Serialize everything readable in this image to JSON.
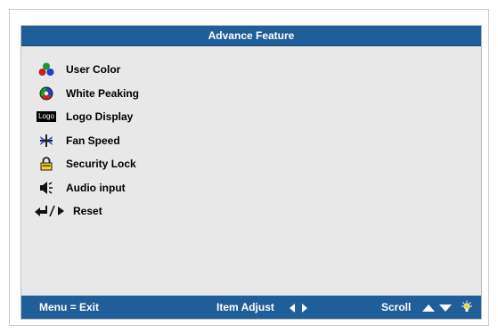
{
  "title": "Advance Feature",
  "menu": [
    {
      "label": "User Color",
      "icon": "user-color-icon"
    },
    {
      "label": "White Peaking",
      "icon": "white-peaking-icon"
    },
    {
      "label": "Logo Display",
      "icon": "logo-display-icon",
      "icon_text": "Logo"
    },
    {
      "label": "Fan Speed",
      "icon": "fan-icon"
    },
    {
      "label": "Security Lock",
      "icon": "lock-icon"
    },
    {
      "label": "Audio input",
      "icon": "speaker-icon"
    },
    {
      "label": "Reset",
      "icon": "reset-icon"
    }
  ],
  "footer": {
    "exit": "Menu = Exit",
    "adjust": "Item Adjust",
    "scroll": "Scroll"
  },
  "colors": {
    "bar": "#1f5e98",
    "panel": "#e8e8e8",
    "lock": "#f2d21b"
  }
}
